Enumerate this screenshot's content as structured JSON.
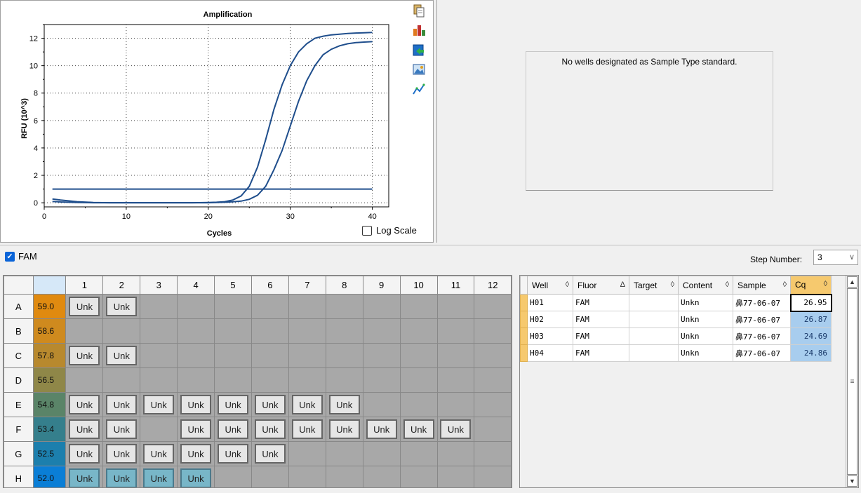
{
  "chart": {
    "toolbar_icons": [
      "copy-icon",
      "chart-settings-icon",
      "export-icon",
      "image-icon",
      "trace-icon"
    ],
    "log_scale_label": "Log Scale",
    "log_scale_checked": false
  },
  "chart_data": {
    "type": "line",
    "title": "Amplification",
    "xlabel": "Cycles",
    "ylabel": "RFU (10^3)",
    "xlim": [
      0,
      42
    ],
    "ylim": [
      -0.3,
      13
    ],
    "x_ticks": [
      0,
      10,
      20,
      30,
      40
    ],
    "y_ticks": [
      0,
      2,
      4,
      6,
      8,
      10,
      12
    ],
    "grid": true,
    "threshold": 1.0,
    "line_color": "#1f4e8c",
    "series": [
      {
        "x": [
          1,
          2,
          4,
          6,
          8,
          10,
          12,
          14,
          16,
          18,
          20,
          21,
          22,
          23,
          24,
          25,
          26,
          27,
          28,
          29,
          30,
          31,
          32,
          33,
          34,
          35,
          36,
          37,
          38,
          39,
          40
        ],
        "y": [
          0.1,
          0.06,
          0.02,
          0.0,
          0.0,
          0.0,
          0.0,
          0.0,
          0.0,
          0.0,
          0.02,
          0.04,
          0.08,
          0.2,
          0.5,
          1.2,
          2.6,
          4.6,
          6.8,
          8.6,
          10.0,
          11.0,
          11.6,
          12.0,
          12.15,
          12.25,
          12.3,
          12.35,
          12.38,
          12.4,
          12.42
        ]
      },
      {
        "x": [
          1,
          2,
          4,
          6,
          8,
          10,
          12,
          14,
          16,
          18,
          20,
          21,
          22,
          23,
          24,
          25,
          26,
          27,
          28,
          29,
          30,
          31,
          32,
          33,
          34,
          35,
          36,
          37,
          38,
          39,
          40
        ],
        "y": [
          0.28,
          0.2,
          0.08,
          0.02,
          0.0,
          0.0,
          0.0,
          0.0,
          0.0,
          0.0,
          0.0,
          0.02,
          0.04,
          0.07,
          0.12,
          0.25,
          0.55,
          1.2,
          2.4,
          3.8,
          5.6,
          7.4,
          8.9,
          10.0,
          10.8,
          11.2,
          11.45,
          11.6,
          11.68,
          11.72,
          11.75
        ]
      }
    ]
  },
  "standard_curve": {
    "message": "No wells designated as Sample Type standard."
  },
  "fluor_bar": {
    "fam_label": "FAM",
    "fam_checked": true,
    "step_label": "Step Number:",
    "step_value": "3"
  },
  "plate": {
    "columns": [
      "1",
      "2",
      "3",
      "4",
      "5",
      "6",
      "7",
      "8",
      "9",
      "10",
      "11",
      "12"
    ],
    "rows": [
      {
        "label": "A",
        "temp": "59.0",
        "color": "#e08a10",
        "wells": [
          "Unk",
          "Unk",
          "",
          "",
          "",
          "",
          "",
          "",
          "",
          "",
          "",
          ""
        ]
      },
      {
        "label": "B",
        "temp": "58.6",
        "color": "#cf8a1e",
        "wells": [
          "",
          "",
          "",
          "",
          "",
          "",
          "",
          "",
          "",
          "",
          "",
          ""
        ]
      },
      {
        "label": "C",
        "temp": "57.8",
        "color": "#b8892e",
        "wells": [
          "Unk",
          "Unk",
          "",
          "",
          "",
          "",
          "",
          "",
          "",
          "",
          "",
          ""
        ]
      },
      {
        "label": "D",
        "temp": "56.5",
        "color": "#8f8748",
        "wells": [
          "",
          "",
          "",
          "",
          "",
          "",
          "",
          "",
          "",
          "",
          "",
          ""
        ]
      },
      {
        "label": "E",
        "temp": "54.8",
        "color": "#5a8468",
        "wells": [
          "Unk",
          "Unk",
          "Unk",
          "Unk",
          "Unk",
          "Unk",
          "Unk",
          "Unk",
          "",
          "",
          "",
          ""
        ]
      },
      {
        "label": "F",
        "temp": "53.4",
        "color": "#357f8c",
        "wells": [
          "Unk",
          "Unk",
          "",
          "Unk",
          "Unk",
          "Unk",
          "Unk",
          "Unk",
          "Unk",
          "Unk",
          "Unk",
          ""
        ]
      },
      {
        "label": "G",
        "temp": "52.5",
        "color": "#1c7fad",
        "wells": [
          "Unk",
          "Unk",
          "Unk",
          "Unk",
          "Unk",
          "Unk",
          "",
          "",
          "",
          "",
          "",
          ""
        ]
      },
      {
        "label": "H",
        "temp": "52.0",
        "color": "#0a7ed6",
        "wells": [
          "Unk",
          "Unk",
          "Unk",
          "Unk",
          "",
          "",
          "",
          "",
          "",
          "",
          "",
          ""
        ],
        "selected": [
          0,
          1,
          2,
          3
        ]
      }
    ]
  },
  "results": {
    "headers": [
      {
        "label": "Well",
        "sort": "◊"
      },
      {
        "label": "Fluor",
        "sort": "Δ"
      },
      {
        "label": "Target",
        "sort": "◊"
      },
      {
        "label": "Content",
        "sort": "◊"
      },
      {
        "label": "Sample",
        "sort": "◊"
      },
      {
        "label": "Cq",
        "sort": "◊"
      }
    ],
    "rows": [
      {
        "well": "H01",
        "fluor": "FAM",
        "target": "",
        "content": "Unkn",
        "sample": "鼻77-06-07",
        "cq": "26.95"
      },
      {
        "well": "H02",
        "fluor": "FAM",
        "target": "",
        "content": "Unkn",
        "sample": "鼻77-06-07",
        "cq": "26.87"
      },
      {
        "well": "H03",
        "fluor": "FAM",
        "target": "",
        "content": "Unkn",
        "sample": "鼻77-06-07",
        "cq": "24.69"
      },
      {
        "well": "H04",
        "fluor": "FAM",
        "target": "",
        "content": "Unkn",
        "sample": "鼻77-06-07",
        "cq": "24.86"
      }
    ]
  }
}
